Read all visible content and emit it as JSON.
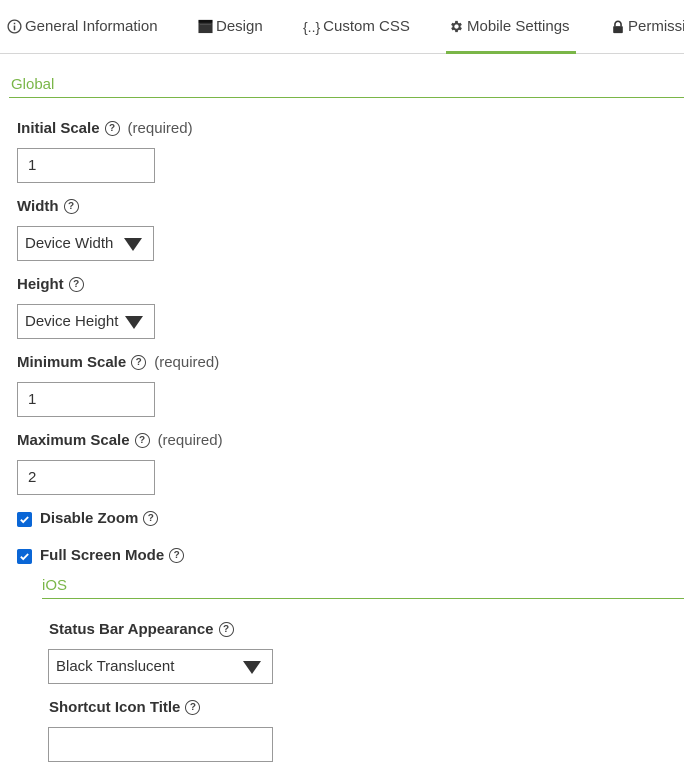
{
  "tabs": [
    {
      "label": "General Information",
      "icon": "info-icon"
    },
    {
      "label": "Design",
      "icon": "design-icon"
    },
    {
      "label": "Custom CSS",
      "icon": "braces-icon"
    },
    {
      "label": "Mobile Settings",
      "icon": "gear-icon"
    },
    {
      "label": "Permissi",
      "icon": "lock-icon"
    }
  ],
  "active_tab": "Mobile Settings",
  "accent_color": "#7ab648",
  "checkbox_color": "#0a66d6",
  "help_glyph": "?",
  "global": {
    "title": "Global",
    "initial_scale": {
      "label": "Initial Scale",
      "required": "(required)",
      "value": "1"
    },
    "width": {
      "label": "Width",
      "selected": "Device Width"
    },
    "height": {
      "label": "Height",
      "selected": "Device Height"
    },
    "minimum_scale": {
      "label": "Minimum Scale",
      "required": "(required)",
      "value": "1"
    },
    "maximum_scale": {
      "label": "Maximum Scale",
      "required": "(required)",
      "value": "2"
    },
    "disable_zoom": {
      "label": "Disable Zoom",
      "checked": true
    },
    "full_screen_mode": {
      "label": "Full Screen Mode",
      "checked": true
    }
  },
  "ios": {
    "title": "iOS",
    "status_bar_appearance": {
      "label": "Status Bar Appearance",
      "selected": "Black Translucent"
    },
    "shortcut_icon_title": {
      "label": "Shortcut Icon Title",
      "value": ""
    }
  }
}
